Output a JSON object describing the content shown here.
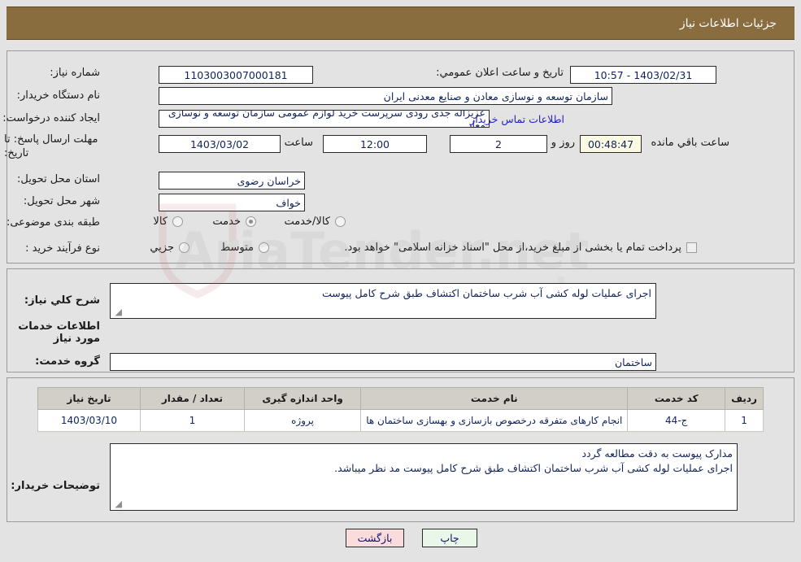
{
  "header": {
    "title": "جزئیات اطلاعات نیاز"
  },
  "top_section": {
    "need_number": {
      "label": "شماره نیاز:",
      "value": "1103003007000181"
    },
    "buyer_org": {
      "label": "نام دستگاه خریدار:",
      "value": "سازمان توسعه و نوسازی معادن و صنایع معدنی ایران"
    },
    "creator": {
      "label": "ایجاد کننده درخواست:",
      "value": "عزیزاله جدی رودی سرپرست خرید لوازم عمومی  سازمان توسعه و نوسازی معاد"
    },
    "contact_link": "اطلاعات تماس خریدار",
    "deadline": {
      "label": "مهلت ارسال پاسخ: تا تاریخ:",
      "date": "1403/03/02",
      "hour_label": "ساعت",
      "hour": "12:00",
      "days": "2",
      "days_suffix": "روز و",
      "countdown": "00:48:47",
      "countdown_suffix": "ساعت باقي مانده"
    },
    "public_announce": {
      "label": "تاریخ و ساعت اعلان عمومي:",
      "value": "1403/02/31 - 10:57"
    },
    "province": {
      "label": "استان محل تحویل:",
      "value": "خراسان رضوی"
    },
    "city": {
      "label": "شهر محل تحویل:",
      "value": "خواف"
    },
    "category": {
      "label": "طبقه بندی موضوعی:",
      "options": [
        {
          "label": "کالا",
          "selected": false
        },
        {
          "label": "خدمت",
          "selected": true
        },
        {
          "label": "کالا/خدمت",
          "selected": false
        }
      ]
    },
    "process_type": {
      "label": "نوع فرآیند خرید :",
      "options": [
        {
          "label": "جزیي",
          "selected": false
        },
        {
          "label": "متوسط",
          "selected": false
        }
      ],
      "checkbox": {
        "label": "پرداخت تمام یا بخشی از مبلغ خرید،از محل \"اسناد خزانه اسلامی\" خواهد بود.",
        "checked": false
      }
    }
  },
  "mid_section": {
    "summary": {
      "label": "شرح كلي نیاز:",
      "value": "اجرای عملیات لوله کشی آب شرب ساختمان اکتشاف طبق شرح کامل پیوست"
    },
    "services_heading": "اطلاعات خدمات مورد نیاز",
    "service_group": {
      "label": "گروه خدمت:",
      "value": "ساختمان"
    }
  },
  "table": {
    "columns": [
      "ردیف",
      "کد خدمت",
      "نام خدمت",
      "واحد اندازه گیری",
      "تعداد / مقدار",
      "تاریخ نیاز"
    ],
    "rows": [
      {
        "row_no": "1",
        "service_code": "ج-44",
        "service_name": "انجام کارهای متفرقه درخصوص بازسازی و بهسازی ساختمان ها",
        "unit": "پروژه",
        "quantity": "1",
        "need_date": "1403/03/10"
      }
    ]
  },
  "buyer_notes": {
    "label": "توضیحات خریدار:",
    "line1": "مدارک پیوست به دقت مطالعه گردد",
    "line2": "اجرای عملیات لوله کشی آب شرب ساختمان اکتشاف طبق شرح کامل پیوست مد نظر میباشد."
  },
  "footer": {
    "print_label": "چاپ",
    "back_label": "بازگشت"
  },
  "colors": {
    "header_bg": "#8a6d3f",
    "page_bg": "#e3e3e3",
    "link": "#2222cc",
    "field_text": "#11235a",
    "table_header_bg": "#d2cfc8",
    "print_btn_bg": "#e8f7e8",
    "back_btn_bg": "#fbdcdc",
    "countdown_bg": "#fbfbe4"
  }
}
